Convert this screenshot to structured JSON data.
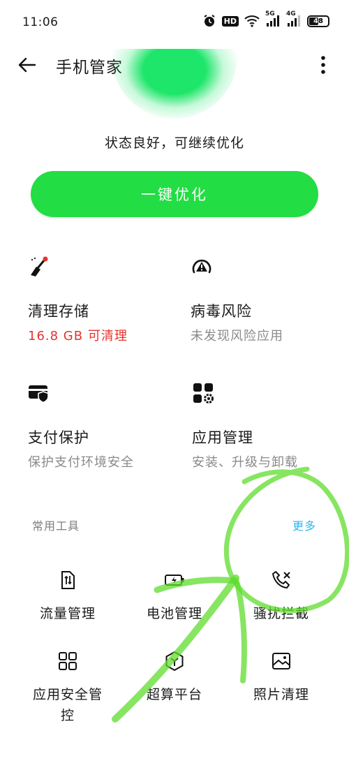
{
  "status_bar": {
    "time": "11:06",
    "hd_label": "HD",
    "net_5g": "5G",
    "net_4g": "4G",
    "battery_level": "48"
  },
  "header": {
    "title": "手机管家",
    "back_icon": "arrow-left-icon",
    "more_icon": "more-vertical-icon"
  },
  "summary": {
    "status_text": "状态良好，可继续优化",
    "optimize_label": "一键优化",
    "accent_color": "#22dd44"
  },
  "features": [
    {
      "icon": "broom-icon",
      "title": "清理存储",
      "subtitle": "16.8 GB 可清理",
      "warn": true
    },
    {
      "icon": "virus-alert-icon",
      "title": "病毒风险",
      "subtitle": "未发现风险应用",
      "warn": false
    },
    {
      "icon": "card-shield-icon",
      "title": "支付保护",
      "subtitle": "保护支付环境安全",
      "warn": false
    },
    {
      "icon": "app-grid-gear-icon",
      "title": "应用管理",
      "subtitle": "安装、升级与卸载",
      "warn": false
    }
  ],
  "tools_section": {
    "label": "常用工具",
    "more_label": "更多",
    "more_color": "#2bb6ee"
  },
  "tools": [
    {
      "icon": "data-traffic-icon",
      "label": "流量管理"
    },
    {
      "icon": "battery-charge-icon",
      "label": "电池管理"
    },
    {
      "icon": "call-block-icon",
      "label": "骚扰拦截"
    },
    {
      "icon": "app-security-icon",
      "label": "应用安全管控"
    },
    {
      "icon": "hexagon-cube-icon",
      "label": "超算平台"
    },
    {
      "icon": "photo-clean-icon",
      "label": "照片清理"
    }
  ]
}
